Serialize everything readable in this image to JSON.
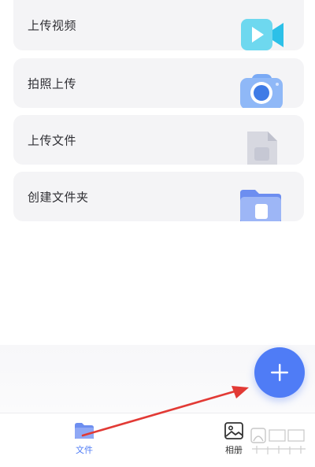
{
  "menu": {
    "items": [
      {
        "label": "上传视频",
        "icon": "video-icon"
      },
      {
        "label": "拍照上传",
        "icon": "camera-icon"
      },
      {
        "label": "上传文件",
        "icon": "file-icon"
      },
      {
        "label": "创建文件夹",
        "icon": "folder-icon"
      }
    ]
  },
  "fab": {
    "icon": "plus-icon"
  },
  "tabbar": {
    "tabs": [
      {
        "label": "文件",
        "icon": "folder-tab-icon",
        "active": true
      },
      {
        "label": "相册",
        "icon": "image-tab-icon",
        "active": false
      }
    ]
  },
  "colors": {
    "accent": "#4f7cf6",
    "card_bg": "#f4f4f6",
    "annotation": "#e23a35"
  }
}
